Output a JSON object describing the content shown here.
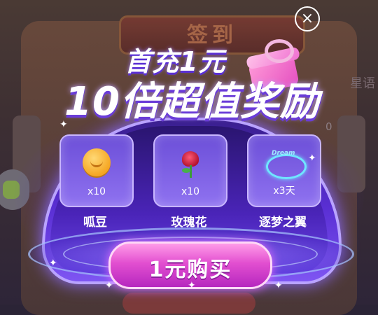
{
  "background": {
    "header_title": "签到",
    "right_text": "星语",
    "right_value": "0"
  },
  "popup": {
    "headline_line1": "首充1元",
    "headline_line2": "10倍超值奖励",
    "rewards": [
      {
        "name": "呱豆",
        "quantity": "x10",
        "icon": "beans-icon"
      },
      {
        "name": "玫瑰花",
        "quantity": "x10",
        "icon": "rose-icon"
      },
      {
        "name": "逐梦之翼",
        "quantity": "x3天",
        "icon": "wings-icon",
        "icon_text": "Dream"
      }
    ],
    "buy_label": "1元购买",
    "close_symbol": "×"
  },
  "colors": {
    "accent_purple": "#5a2fd4",
    "button_pink": "#e24fd0",
    "card_purple": "#8f72f0"
  }
}
